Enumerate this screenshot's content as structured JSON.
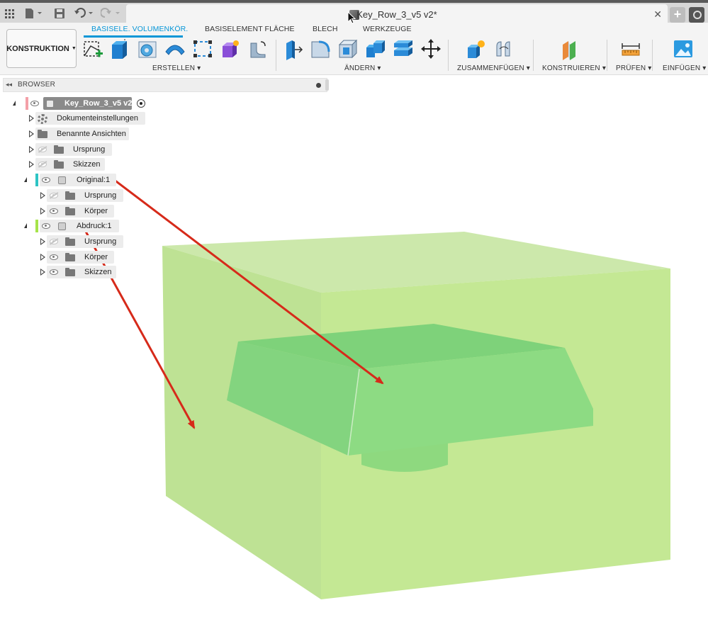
{
  "titlebar": {
    "document_title": "Key_Row_3_v5 v2*",
    "icons": [
      "grid-icon",
      "file-icon",
      "save-icon",
      "undo-icon",
      "redo-icon",
      "close-icon",
      "plus-icon",
      "help-icon"
    ]
  },
  "ribbon": {
    "workspace_label": "KONSTRUKTION",
    "tabs": [
      {
        "label": "BASISELE. VOLUMENKÖR.",
        "active": true
      },
      {
        "label": "BASISELEMENT FLÄCHE",
        "active": false
      },
      {
        "label": "BLECH",
        "active": false
      },
      {
        "label": "WERKZEUGE",
        "active": false
      }
    ],
    "groups": {
      "create": "ERSTELLEN",
      "modify": "ÄNDERN",
      "assemble": "ZUSAMMENFÜGEN",
      "construct": "KONSTRUIEREN",
      "inspect": "PRÜFEN",
      "insert": "EINFÜGEN"
    },
    "accent_color": "#0696d7"
  },
  "browser": {
    "title": "BROWSER",
    "root": {
      "label": "Key_Row_3_v5 v2",
      "color": "#f4a0a8"
    },
    "items": [
      {
        "label": "Dokumenteinstellungen"
      },
      {
        "label": "Benannte Ansichten"
      },
      {
        "label": "Ursprung"
      },
      {
        "label": "Skizzen"
      }
    ],
    "component1": {
      "label": "Original:1",
      "color": "#2ec4c4",
      "children": [
        {
          "label": "Ursprung"
        },
        {
          "label": "Körper"
        }
      ]
    },
    "component2": {
      "label": "Abdruck:1",
      "color": "#a6e34a",
      "children": [
        {
          "label": "Ursprung"
        },
        {
          "label": "Körper"
        },
        {
          "label": "Skizzen"
        }
      ]
    }
  },
  "viewport": {
    "mold_color": "#b5e27a",
    "key_color": "#7fd47a",
    "arrow_color": "#d62a1a"
  }
}
